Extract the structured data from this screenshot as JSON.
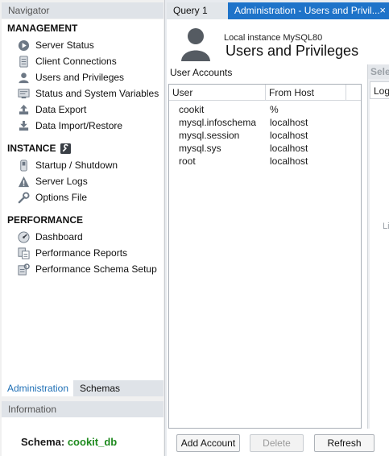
{
  "navigator": {
    "title": "Navigator",
    "sections": [
      {
        "title": "MANAGEMENT",
        "items": [
          {
            "label": "Server Status",
            "icon": "server-status-icon"
          },
          {
            "label": "Client Connections",
            "icon": "client-connections-icon"
          },
          {
            "label": "Users and Privileges",
            "icon": "users-icon"
          },
          {
            "label": "Status and System Variables",
            "icon": "variables-icon"
          },
          {
            "label": "Data Export",
            "icon": "data-export-icon"
          },
          {
            "label": "Data Import/Restore",
            "icon": "data-import-icon"
          }
        ]
      },
      {
        "title": "INSTANCE",
        "title_icon": "wrench-badge-icon",
        "items": [
          {
            "label": "Startup / Shutdown",
            "icon": "startup-shutdown-icon"
          },
          {
            "label": "Server Logs",
            "icon": "warning-icon"
          },
          {
            "label": "Options File",
            "icon": "wrench-icon"
          }
        ]
      },
      {
        "title": "PERFORMANCE",
        "items": [
          {
            "label": "Dashboard",
            "icon": "dashboard-icon"
          },
          {
            "label": "Performance Reports",
            "icon": "reports-icon"
          },
          {
            "label": "Performance Schema Setup",
            "icon": "schema-setup-icon"
          }
        ]
      }
    ],
    "bottom_tabs": [
      "Administration",
      "Schemas"
    ],
    "active_bottom_tab": "Administration"
  },
  "information": {
    "title": "Information",
    "schema_label": "Schema:",
    "schema_value": "cookit_db"
  },
  "tabs": [
    {
      "label": "Query 1"
    },
    {
      "label": "Administration - Users and Privil...",
      "active": true,
      "close": "×"
    }
  ],
  "header": {
    "instance": "Local instance MySQL80",
    "title": "Users and Privileges"
  },
  "user_accounts": {
    "label": "User Accounts",
    "columns": [
      "User",
      "From Host"
    ],
    "rows": [
      {
        "user": "cookit",
        "host": "%"
      },
      {
        "user": "mysql.infoschema",
        "host": "localhost"
      },
      {
        "user": "mysql.session",
        "host": "localhost"
      },
      {
        "user": "mysql.sys",
        "host": "localhost"
      },
      {
        "user": "root",
        "host": "localhost"
      }
    ]
  },
  "buttons": {
    "add": "Add Account",
    "delete": "Delete",
    "refresh": "Refresh"
  },
  "side_panel": {
    "header": "Selec",
    "tab": "Login",
    "hint": "Li"
  },
  "colors": {
    "accent": "#1e73c9",
    "schema_value": "#1e8a1e",
    "active_bottom_tab_text": "#1e6fb5"
  }
}
